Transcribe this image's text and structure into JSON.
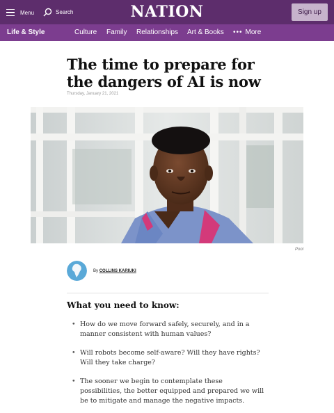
{
  "header": {
    "menu_label": "Menu",
    "search_label": "Search",
    "logo": "NATION",
    "signup_label": "Sign up"
  },
  "subnav": {
    "section": "Life & Style",
    "links": [
      "Culture",
      "Family",
      "Relationships",
      "Art & Books"
    ],
    "more_label": "More"
  },
  "article": {
    "headline": "The time to prepare for the dangers of AI is now",
    "date": "Thursday, January 21, 2021",
    "photo_caption": "Pool",
    "author_prefix": "By",
    "author_name": "COLLINS KARIUKI",
    "key_points_heading": "What you need to know:",
    "key_points": [
      "How do we move forward safely, securely, and in a manner consistent with human values?",
      "Will robots become self-aware? Will they have rights? Will they take charge?",
      "The sooner we begin to contemplate these possibilities, the better equipped and prepared we will be to mitigate and manage the negative impacts."
    ]
  },
  "colors": {
    "header_bg": "#5d2d6c",
    "subnav_bg": "#7c3d8f",
    "signup_bg": "#c7b3cc"
  },
  "icons": [
    "menu-icon",
    "search-icon",
    "more-dots-icon",
    "africa-globe-icon"
  ]
}
